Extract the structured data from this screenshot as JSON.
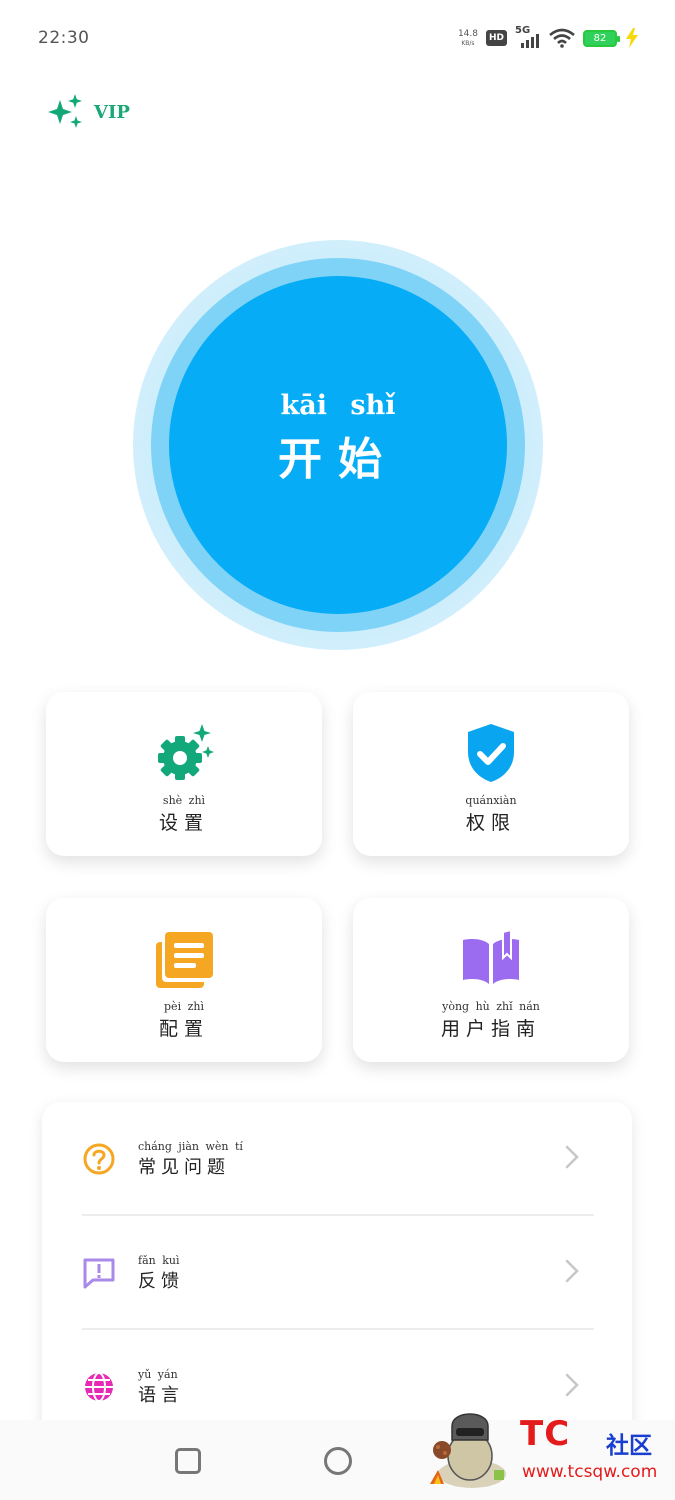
{
  "status_bar": {
    "time": "22:30",
    "net_speed_value": "14.8",
    "net_speed_unit": "KB/s",
    "hd": "HD",
    "network": "5G",
    "battery": "82"
  },
  "header": {
    "vip_label": "VIP",
    "vip_icon": "sparkle-icon"
  },
  "start": {
    "pinyin": "kāi shǐ",
    "label": "开始"
  },
  "cards": [
    {
      "pinyin": "shè zhì",
      "label": "设置",
      "icon": "settings-gear-icon",
      "color": "#12a87a"
    },
    {
      "pinyin": "quánxiàn",
      "label": "权限",
      "icon": "shield-check-icon",
      "color": "#0aa5f0"
    },
    {
      "pinyin": "pèi zhì",
      "label": "配置",
      "icon": "documents-icon",
      "color": "#f5a623"
    },
    {
      "pinyin": "yòng hù zhǐ nán",
      "label": "用户指南",
      "icon": "book-icon",
      "color": "#9b6cf0"
    }
  ],
  "menu": [
    {
      "pinyin": "cháng jiàn wèn tí",
      "label": "常见问题",
      "icon": "question-icon",
      "color": "#f5a623"
    },
    {
      "pinyin": "fǎn kuì",
      "label": "反馈",
      "icon": "feedback-icon",
      "color": "#a98ae8"
    },
    {
      "pinyin": "yǔ yán",
      "label": "语言",
      "icon": "globe-icon",
      "color": "#e62ab5"
    }
  ],
  "watermark": {
    "brand": "TC",
    "community": "社区",
    "url": "www.tcsqw.com"
  }
}
